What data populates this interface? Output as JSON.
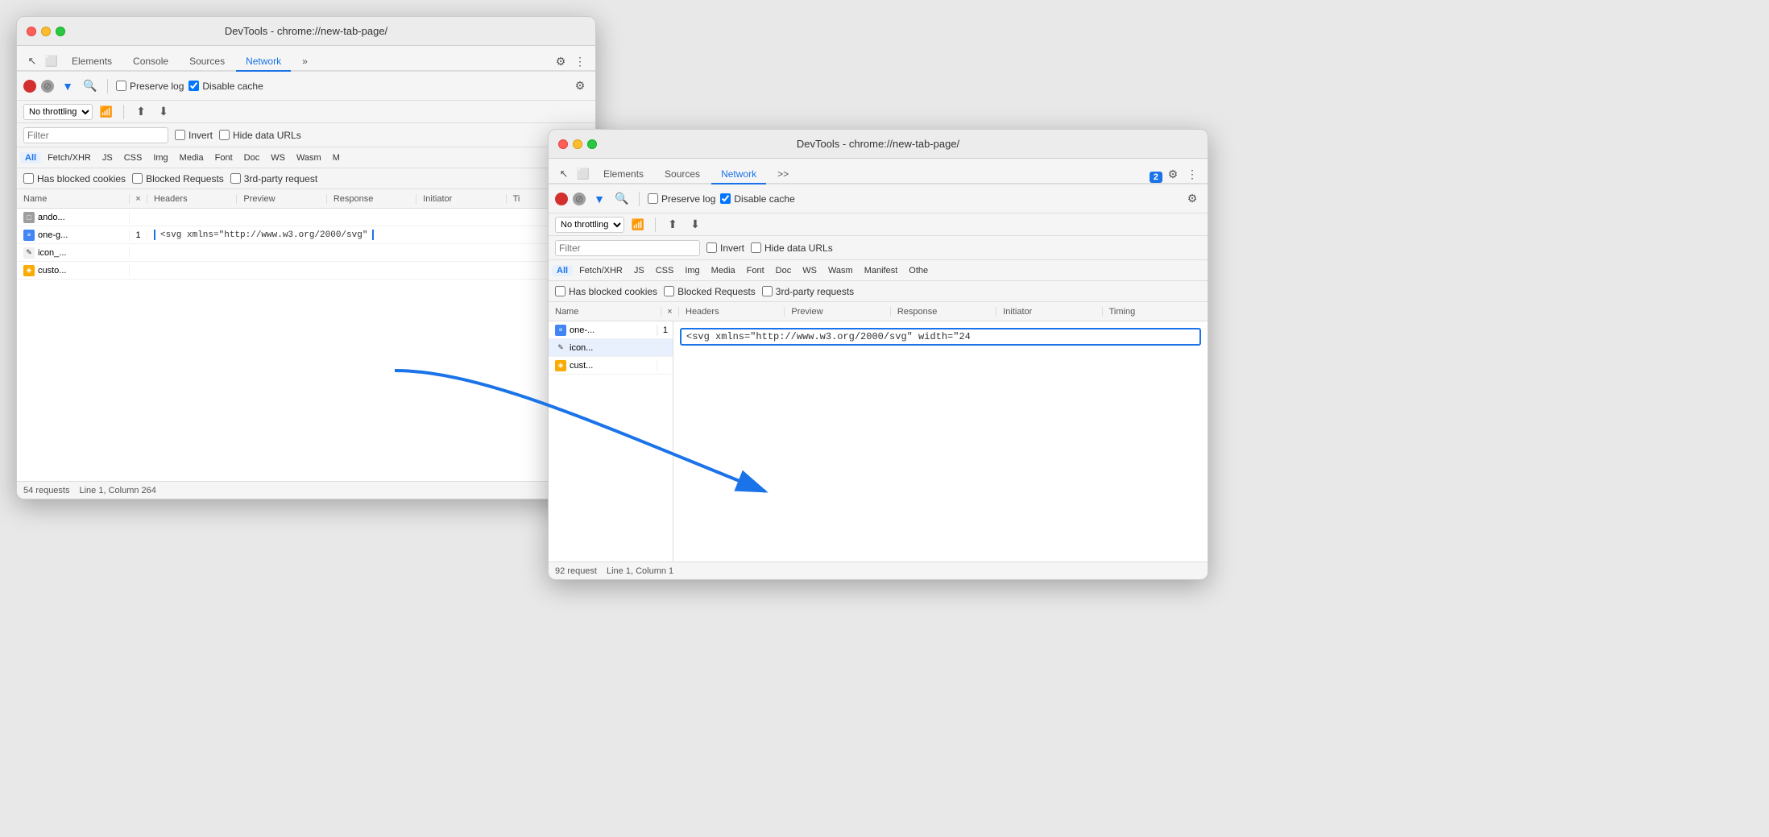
{
  "window_back": {
    "title": "DevTools - chrome://new-tab-page/",
    "tabs": [
      "Elements",
      "Console",
      "Sources",
      "Network",
      "»"
    ],
    "active_tab": "Network",
    "filter_placeholder": "Filter",
    "preserve_log": "Preserve log",
    "disable_cache": "Disable cache",
    "no_throttling": "No throttling",
    "type_filters": [
      "All",
      "Fetch/XHR",
      "JS",
      "CSS",
      "Img",
      "Media",
      "Font",
      "Doc",
      "WS",
      "Wasm",
      "M"
    ],
    "active_type": "All",
    "cookies": "Has blocked cookies",
    "blocked_requests": "Blocked Requests",
    "third_party": "3rd-party request",
    "columns": [
      "Name",
      "×",
      "Headers",
      "Preview",
      "Response",
      "Initiator",
      "Ti"
    ],
    "rows": [
      {
        "icon": "gray",
        "name": "ando...",
        "x": "",
        "response": ""
      },
      {
        "icon": "svg",
        "name": "one-g...",
        "x": "1",
        "response": "<svg xmlns=\"http://www.w3.org/2000/svg\""
      },
      {
        "icon": "pencil",
        "name": "icon_...",
        "x": "",
        "response": ""
      },
      {
        "icon": "yellow",
        "name": "custo...",
        "x": "",
        "response": ""
      }
    ],
    "status": "54 requests",
    "position": "Line 1, Column 264"
  },
  "window_front": {
    "title": "DevTools - chrome://new-tab-page/",
    "tabs": [
      "Elements",
      "Sources",
      "Network",
      "»"
    ],
    "active_tab": "Network",
    "badge": "2",
    "filter_placeholder": "Filter",
    "preserve_log": "Preserve log",
    "disable_cache": "Disable cache",
    "no_throttling": "No throttling",
    "type_filters": [
      "All",
      "Fetch/XHR",
      "JS",
      "CSS",
      "Img",
      "Media",
      "Font",
      "Doc",
      "WS",
      "Wasm",
      "Manifest",
      "Othe"
    ],
    "active_type": "All",
    "cookies": "Has blocked cookies",
    "blocked_requests": "Blocked Requests",
    "third_party": "3rd-party requests",
    "columns": [
      "Name",
      "×",
      "Headers",
      "Preview",
      "Response",
      "Initiator",
      "Timing"
    ],
    "rows": [
      {
        "icon": "svg",
        "name": "one-...",
        "x": "1",
        "selected": false
      },
      {
        "icon": "pencil",
        "name": "icon...",
        "x": "",
        "selected": true
      },
      {
        "icon": "yellow",
        "name": "cust...",
        "x": "",
        "selected": false
      }
    ],
    "response": "<svg xmlns=\"http://www.w3.org/2000/svg\" width=\"24",
    "status": "92 request",
    "position": "Line 1, Column 1"
  },
  "icons": {
    "record": "⏺",
    "stop": "⊘",
    "filter": "▼",
    "search": "🔍",
    "upload": "⬆",
    "download": "⬇",
    "gear": "⚙",
    "more": "⋮",
    "inspect": "↖",
    "device": "⬜",
    "wifi": "📶",
    "chevron": "▾"
  }
}
